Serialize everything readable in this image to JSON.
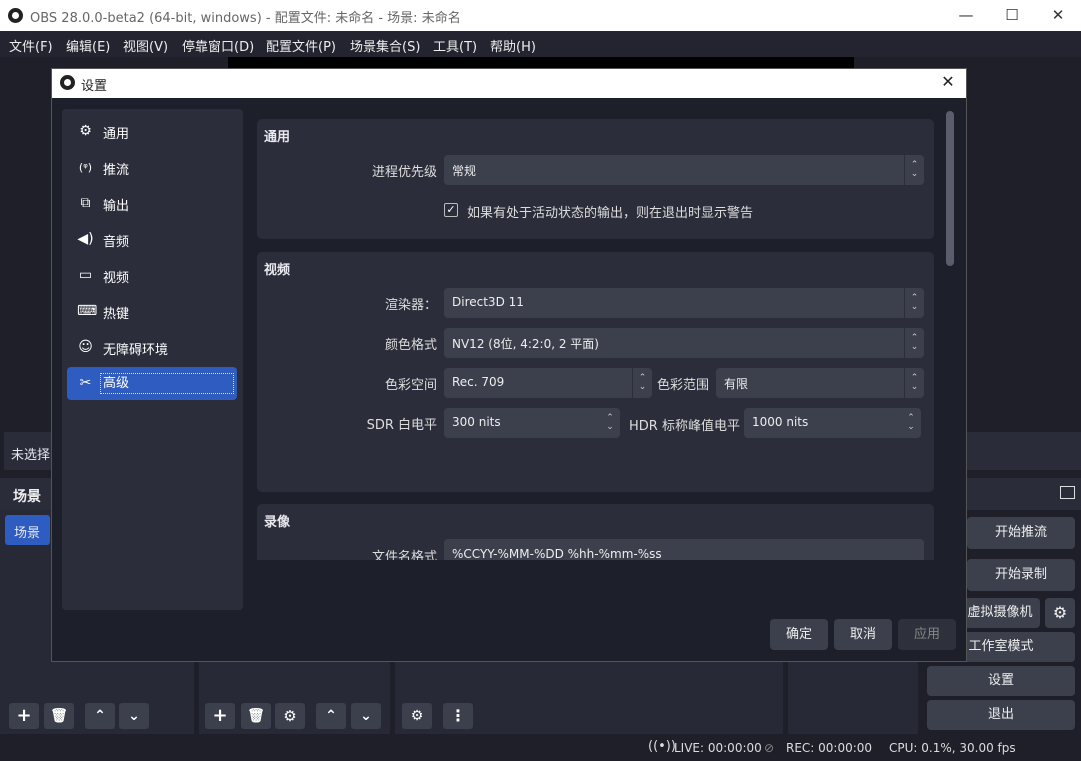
{
  "window": {
    "title": "OBS 28.0.0-beta2 (64-bit, windows) - 配置文件: 未命名 - 场景: 未命名",
    "minimize": "—",
    "maximize": "☐",
    "close": "✕"
  },
  "menu": [
    "文件(F)",
    "编辑(E)",
    "视图(V)",
    "停靠窗口(D)",
    "配置文件(P)",
    "场景集合(S)",
    "工具(T)",
    "帮助(H)"
  ],
  "main": {
    "no_source_label": "未选择",
    "scenes_dock_title": "场景",
    "scene_items": [
      "场景"
    ],
    "controls": {
      "start_stream": "开始推流",
      "start_record": "开始录制",
      "virtual_cam": "虚拟摄像机",
      "studio_mode": "工作室模式",
      "settings": "设置",
      "exit": "退出"
    },
    "toolbar_icons": [
      "plus-icon",
      "trash-icon",
      "arrow-up-icon",
      "arrow-down-icon",
      "gear-icon",
      "more-icon"
    ]
  },
  "status": {
    "live": "LIVE: 00:00:00",
    "rec": "REC: 00:00:00",
    "cpu": "CPU: 0.1%, 30.00 fps"
  },
  "dialog": {
    "title": "设置",
    "close": "✕",
    "sidebar": [
      {
        "icon": "gear-icon",
        "label": "通用"
      },
      {
        "icon": "antenna-icon",
        "label": "推流"
      },
      {
        "icon": "output-icon",
        "label": "输出"
      },
      {
        "icon": "speaker-icon",
        "label": "音频"
      },
      {
        "icon": "monitor-icon",
        "label": "视频"
      },
      {
        "icon": "keyboard-icon",
        "label": "热键"
      },
      {
        "icon": "accessibility-icon",
        "label": "无障碍环境"
      },
      {
        "icon": "tools-icon",
        "label": "高级",
        "selected": true
      }
    ],
    "general": {
      "title": "通用",
      "priority_label": "进程优先级",
      "priority_value": "常规",
      "warn_checkbox_label": "如果有处于活动状态的输出，则在退出时显示警告",
      "warn_checked": true
    },
    "video": {
      "title": "视频",
      "renderer_label": "渲染器：",
      "renderer_value": "Direct3D 11",
      "color_format_label": "颜色格式",
      "color_format_value": "NV12 (8位, 4:2:0, 2 平面)",
      "color_space_label": "色彩空间",
      "color_space_value": "Rec. 709",
      "color_range_label": "色彩范围",
      "color_range_value": "有限",
      "sdr_label": "SDR 白电平",
      "sdr_value": "300 nits",
      "hdr_label": "HDR 标称峰值电平",
      "hdr_value": "1000 nits"
    },
    "recording": {
      "title": "录像",
      "filename_label": "文件名格式",
      "filename_value": "%CCYY-%MM-%DD %hh-%mm-%ss"
    },
    "buttons": {
      "ok": "确定",
      "cancel": "取消",
      "apply": "应用"
    }
  }
}
